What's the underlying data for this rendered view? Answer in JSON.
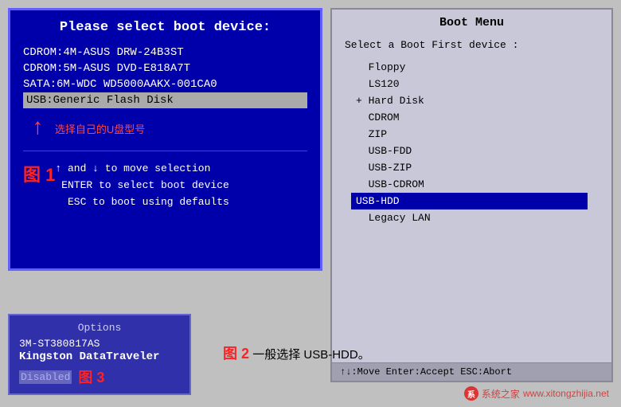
{
  "bios": {
    "title": "Please select boot device:",
    "items": [
      "CDROM:4M-ASUS DRW-24B3ST",
      "CDROM:5M-ASUS DVD-E818A7T",
      "SATA:6M-WDC WD5000AAKX-001CA0",
      "USB:Generic Flash Disk"
    ],
    "selected_index": 3,
    "instructions": [
      "↑ and ↓ to move selection",
      "ENTER to select boot device",
      "ESC to boot using defaults"
    ],
    "fig1_label": "图 1",
    "arrow_label": "选择自己的U盘型号"
  },
  "boot_menu": {
    "title": "Boot Menu",
    "subtitle": "Select a Boot First device :",
    "items": [
      {
        "label": "Floppy",
        "selected": false,
        "marker": false
      },
      {
        "label": "LS120",
        "selected": false,
        "marker": false
      },
      {
        "label": "Hard Disk",
        "selected": false,
        "marker": true
      },
      {
        "label": "CDROM",
        "selected": false,
        "marker": false
      },
      {
        "label": "ZIP",
        "selected": false,
        "marker": false
      },
      {
        "label": "USB-FDD",
        "selected": false,
        "marker": false
      },
      {
        "label": "USB-ZIP",
        "selected": false,
        "marker": false
      },
      {
        "label": "USB-CDROM",
        "selected": false,
        "marker": false
      },
      {
        "label": "USB-HDD",
        "selected": true,
        "marker": false
      },
      {
        "label": "Legacy LAN",
        "selected": false,
        "marker": false
      }
    ],
    "footer": "↑↓:Move  Enter:Accept  ESC:Abort"
  },
  "options_panel": {
    "title": "Options",
    "items": [
      "3M-ST380817AS",
      "Kingston DataTraveler",
      "Disabled"
    ],
    "fig3_label": "图 3"
  },
  "fig2": {
    "label": "图 2",
    "text": "一般选择 USB-HDD。"
  },
  "watermark": {
    "text": "系统之家",
    "url_hint": "www.xitongzhijia.net"
  }
}
